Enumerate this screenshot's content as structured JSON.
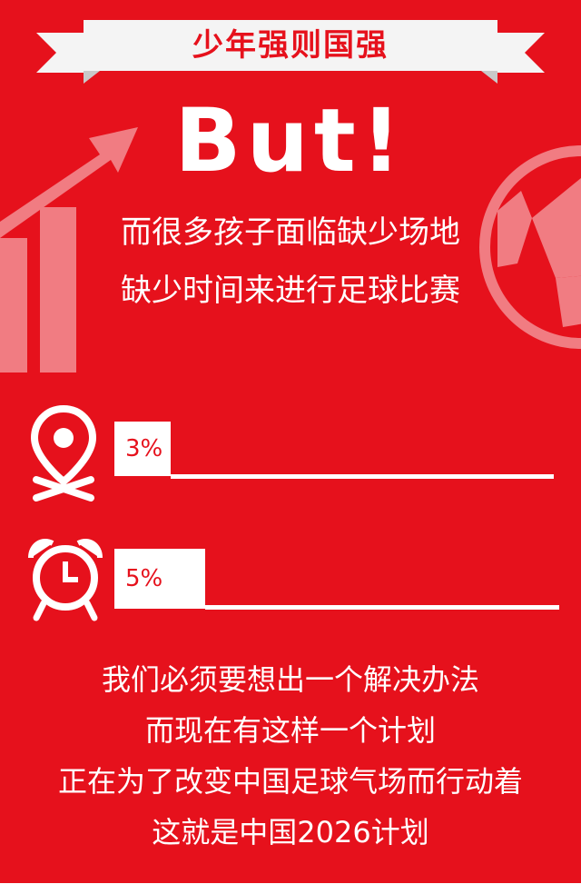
{
  "banner": {
    "title": "少年强则国强"
  },
  "headline": "But!",
  "intro_lines": [
    "而很多孩子面临缺少场地",
    "缺少时间来进行足球比赛"
  ],
  "stats": [
    {
      "icon": "location-pin-icon",
      "value": "3%",
      "fraction": 0.03
    },
    {
      "icon": "alarm-clock-icon",
      "value": "5%",
      "fraction": 0.05
    }
  ],
  "outro_lines": [
    "我们必须要想出一个解决办法",
    "而现在有这样一个计划",
    "正在为了改变中国足球气场而行动着",
    "这就是中国2026计划"
  ],
  "colors": {
    "background": "#e6111c",
    "banner": "#f4f4f4",
    "text": "#ffffff"
  }
}
